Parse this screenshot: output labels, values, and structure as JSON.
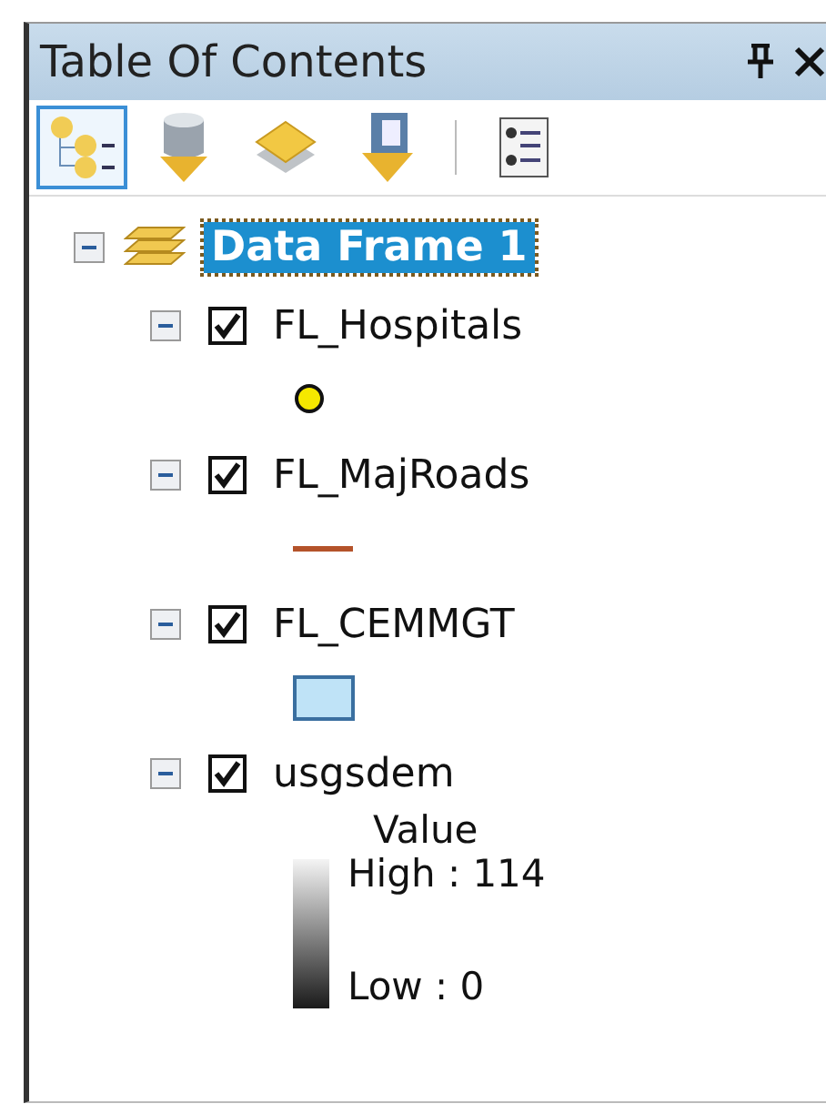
{
  "panel": {
    "title": "Table Of Contents"
  },
  "toolbar": [
    {
      "kind": "drawing-order",
      "selected": true
    },
    {
      "kind": "source",
      "selected": false
    },
    {
      "kind": "visibility",
      "selected": false
    },
    {
      "kind": "selection",
      "selected": false
    },
    {
      "kind": "options",
      "selected": false
    }
  ],
  "frame": {
    "label": "Data Frame 1",
    "expanded": true,
    "selected": true
  },
  "layers": [
    {
      "name": "FL_Hospitals",
      "expanded": true,
      "checked": true,
      "symbol": {
        "kind": "point",
        "color": "#f5e800"
      }
    },
    {
      "name": "FL_MajRoads",
      "expanded": true,
      "checked": true,
      "symbol": {
        "kind": "line",
        "color": "#b4532a"
      }
    },
    {
      "name": "FL_CEMMGT",
      "expanded": true,
      "checked": true,
      "symbol": {
        "kind": "polygon",
        "color": "#bfe3f7"
      }
    },
    {
      "name": "usgsdem",
      "expanded": true,
      "checked": true,
      "symbol": {
        "kind": "ramp",
        "heading": "Value",
        "high": "High : 114",
        "low": "Low : 0"
      }
    }
  ]
}
